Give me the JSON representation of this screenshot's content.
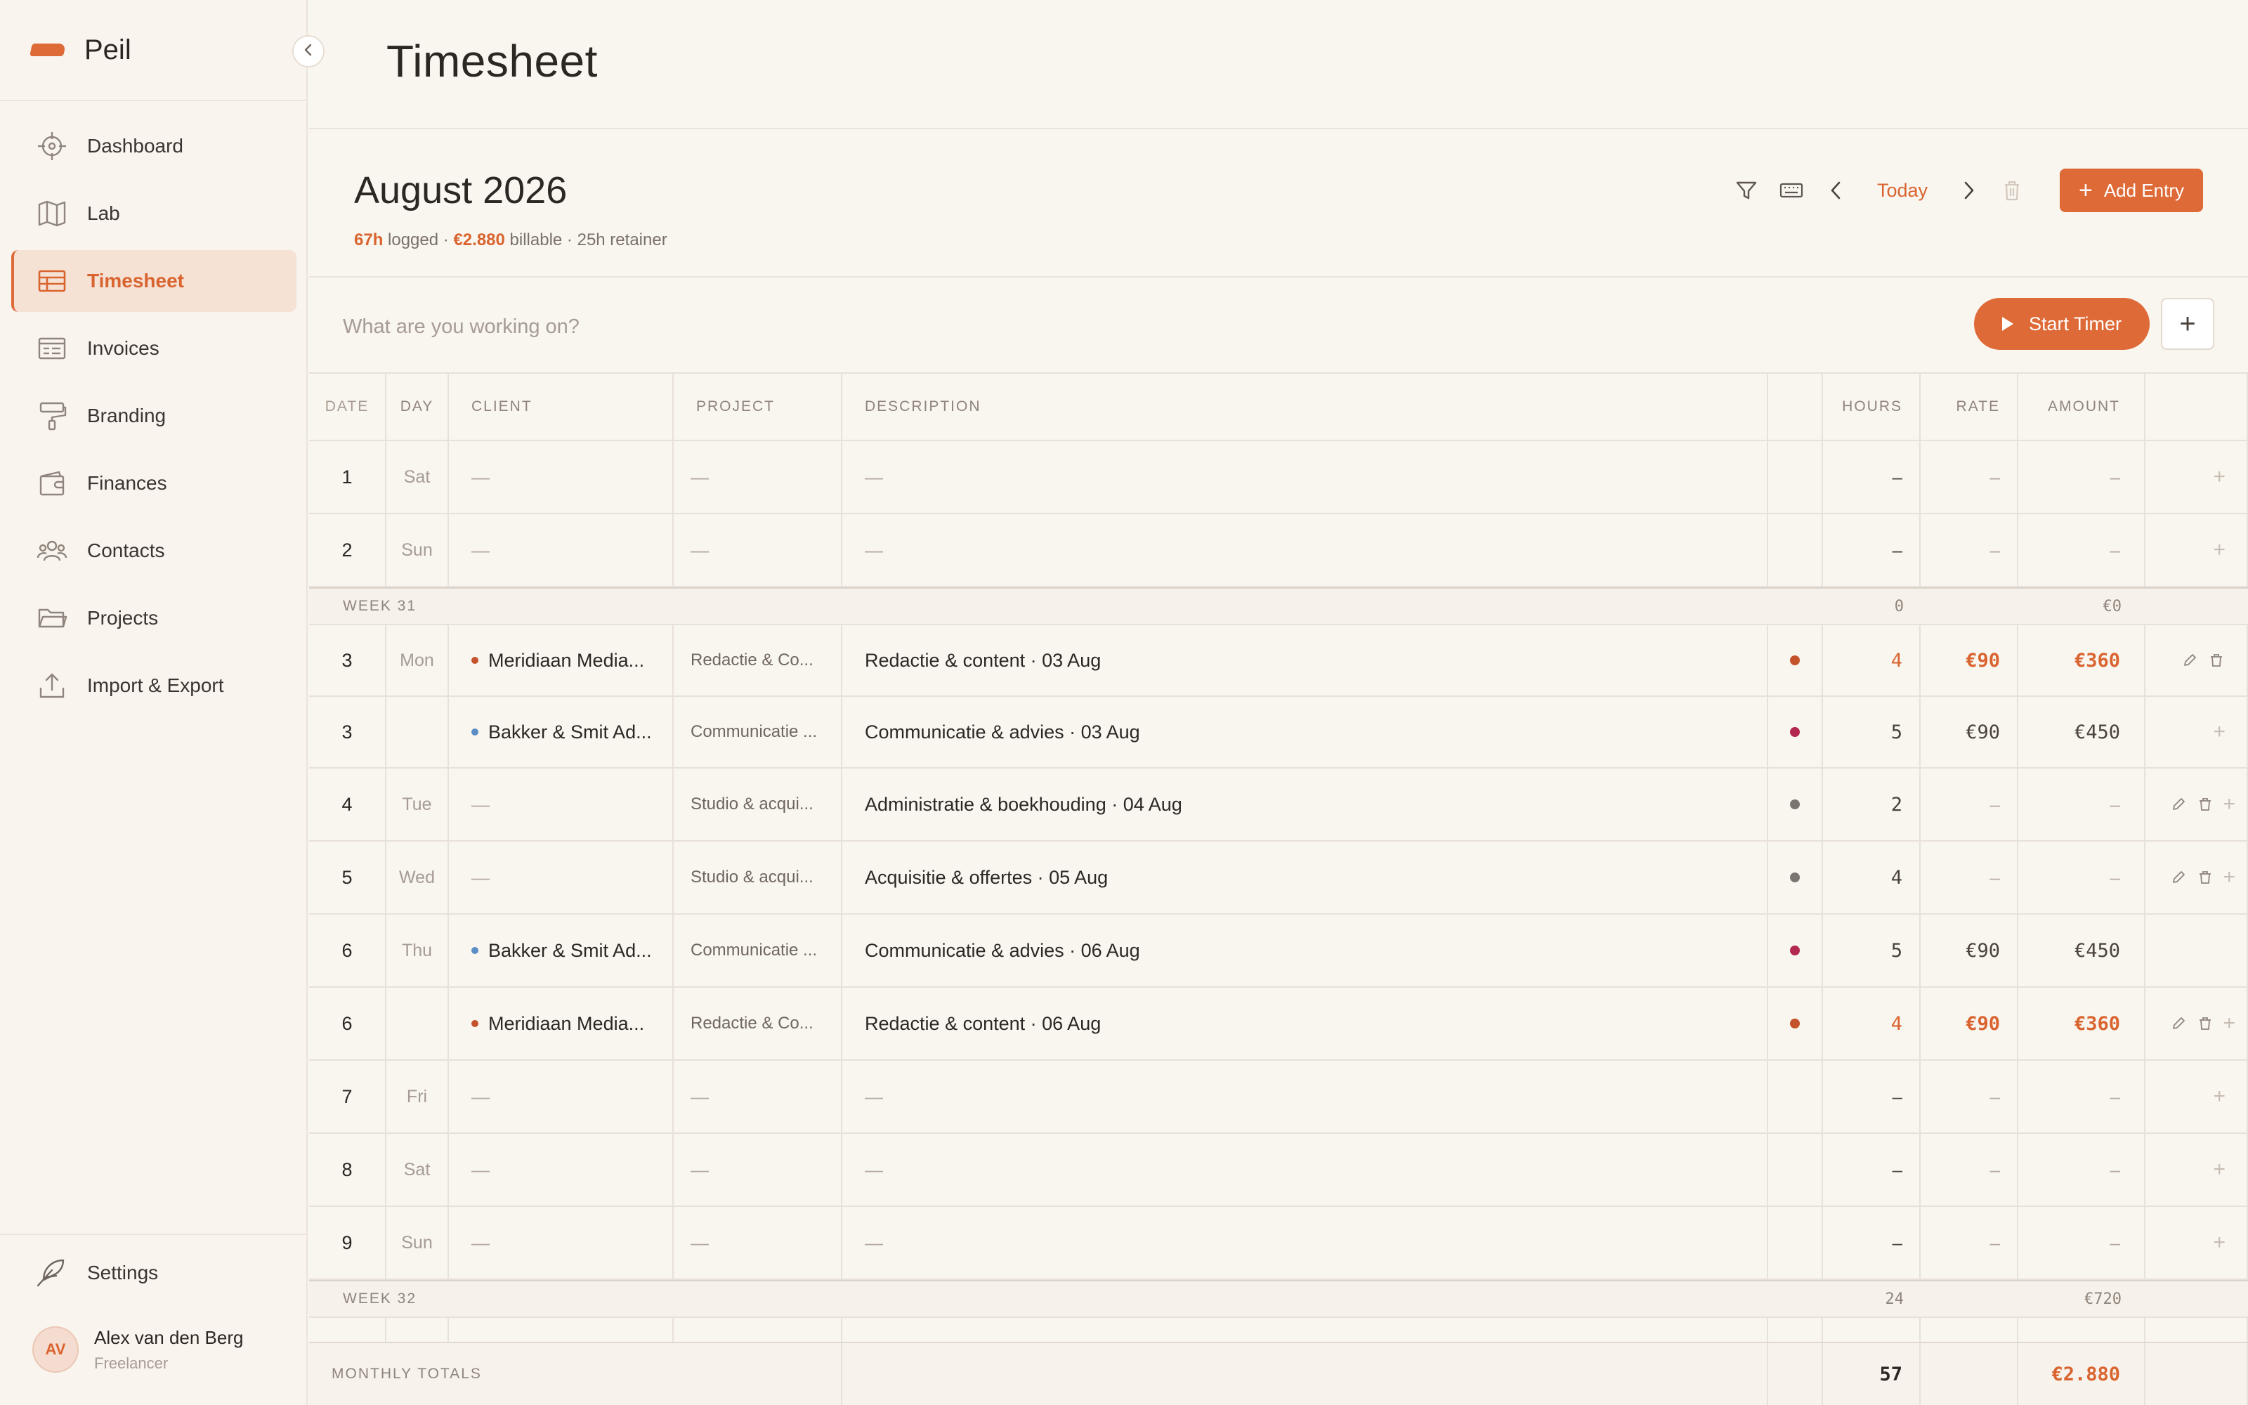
{
  "app": {
    "name": "Peil"
  },
  "sidebar": {
    "items": [
      {
        "label": "Dashboard",
        "icon": "compass-icon"
      },
      {
        "label": "Lab",
        "icon": "map-icon"
      },
      {
        "label": "Timesheet",
        "icon": "table-icon",
        "active": true
      },
      {
        "label": "Invoices",
        "icon": "invoice-icon"
      },
      {
        "label": "Branding",
        "icon": "paint-roller-icon"
      },
      {
        "label": "Finances",
        "icon": "wallet-icon"
      },
      {
        "label": "Contacts",
        "icon": "people-icon"
      },
      {
        "label": "Projects",
        "icon": "folder-icon"
      },
      {
        "label": "Import & Export",
        "icon": "upload-icon"
      }
    ],
    "settings_label": "Settings",
    "user": {
      "initials": "AV",
      "name": "Alex van den Berg",
      "role": "Freelancer"
    }
  },
  "page": {
    "title": "Timesheet"
  },
  "period": {
    "title": "August 2026",
    "logged_value": "67h",
    "logged_label": "logged",
    "separator": "·",
    "billable_value": "€2.880",
    "billable_label": "billable",
    "retainer": "25h retainer"
  },
  "toolbar": {
    "today_label": "Today",
    "add_entry_label": "Add Entry",
    "add_entry_plus": "+"
  },
  "timer": {
    "placeholder": "What are you working on?",
    "start_label": "Start Timer",
    "plus_label": "+"
  },
  "table": {
    "headers": {
      "date": "DATE",
      "day": "DAY",
      "client": "CLIENT",
      "project": "PROJECT",
      "description": "DESCRIPTION",
      "hours": "HOURS",
      "rate": "RATE",
      "amount": "AMOUNT"
    },
    "rows": [
      {
        "type": "entry",
        "date": "1",
        "day": "Sat",
        "client": "—",
        "project": "—",
        "description": "—",
        "hours": "–",
        "rate": "–",
        "amount": "–",
        "empty": true
      },
      {
        "type": "entry",
        "date": "2",
        "day": "Sun",
        "client": "—",
        "project": "—",
        "description": "—",
        "hours": "–",
        "rate": "–",
        "amount": "–",
        "empty": true
      },
      {
        "type": "week",
        "label": "WEEK 31",
        "hours": "0",
        "amount": "€0"
      },
      {
        "type": "entry",
        "date": "3",
        "day": "Mon",
        "client": "Meridiaan Media...",
        "client_color": "#c4522a",
        "project": "Redactie & Co...",
        "description": "Redactie & content · 03 Aug",
        "status_color": "#c4522a",
        "hours": "4",
        "rate": "€90",
        "amount": "€360",
        "highlight": true,
        "actions": "edit-delete"
      },
      {
        "type": "entry",
        "date": "3",
        "day": "",
        "client": "Bakker & Smit Ad...",
        "client_color": "#5b8ec4",
        "project": "Communicatie ...",
        "description": "Communicatie & advies · 03 Aug",
        "status_color": "#b3284d",
        "hours": "5",
        "rate": "€90",
        "amount": "€450",
        "actions": "plus"
      },
      {
        "type": "entry",
        "date": "4",
        "day": "Tue",
        "client": "—",
        "project": "Studio & acqui...",
        "description": "Administratie & boekhouding · 04 Aug",
        "status_color": "#7b7470",
        "hours": "2",
        "rate": "–",
        "amount": "–",
        "actions": "edit-delete-plus"
      },
      {
        "type": "entry",
        "date": "5",
        "day": "Wed",
        "client": "—",
        "project": "Studio & acqui...",
        "description": "Acquisitie & offertes · 05 Aug",
        "status_color": "#7b7470",
        "hours": "4",
        "rate": "–",
        "amount": "–",
        "actions": "edit-delete-plus"
      },
      {
        "type": "entry",
        "date": "6",
        "day": "Thu",
        "client": "Bakker & Smit Ad...",
        "client_color": "#5b8ec4",
        "project": "Communicatie ...",
        "description": "Communicatie & advies · 06 Aug",
        "status_color": "#b3284d",
        "hours": "5",
        "rate": "€90",
        "amount": "€450",
        "actions": "none"
      },
      {
        "type": "entry",
        "date": "6",
        "day": "",
        "client": "Meridiaan Media...",
        "client_color": "#c4522a",
        "project": "Redactie & Co...",
        "description": "Redactie & content · 06 Aug",
        "status_color": "#c4522a",
        "hours": "4",
        "rate": "€90",
        "amount": "€360",
        "highlight": true,
        "actions": "edit-delete-plus"
      },
      {
        "type": "entry",
        "date": "7",
        "day": "Fri",
        "client": "—",
        "project": "—",
        "description": "—",
        "hours": "–",
        "rate": "–",
        "amount": "–",
        "empty": true
      },
      {
        "type": "entry",
        "date": "8",
        "day": "Sat",
        "client": "—",
        "project": "—",
        "description": "—",
        "hours": "–",
        "rate": "–",
        "amount": "–",
        "empty": true
      },
      {
        "type": "entry",
        "date": "9",
        "day": "Sun",
        "client": "—",
        "project": "—",
        "description": "—",
        "hours": "–",
        "rate": "–",
        "amount": "–",
        "empty": true
      },
      {
        "type": "week",
        "label": "WEEK 32",
        "hours": "24",
        "amount": "€720"
      }
    ],
    "totals": {
      "label": "MONTHLY TOTALS",
      "hours": "57",
      "amount": "€2.880"
    }
  },
  "colors": {
    "accent": "#de6a37",
    "accent_text": "#d9642f",
    "background": "#f9f5ef"
  }
}
